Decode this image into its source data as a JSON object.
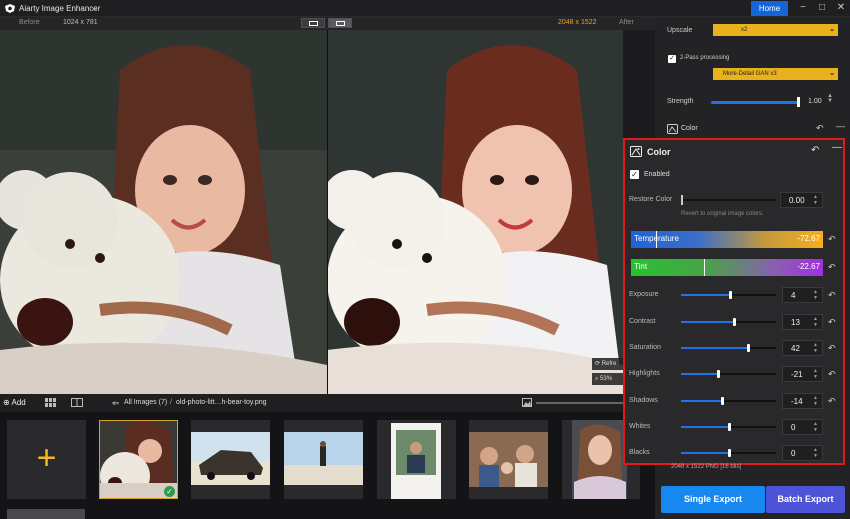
{
  "app": {
    "title": "Aiarty Image Enhancer",
    "dropdown_icon": "chevron-down-icon"
  },
  "titlebar": {
    "home_label": "Home",
    "minimize_glyph": "−",
    "maximize_glyph": "□",
    "close_glyph": "✕"
  },
  "compare": {
    "before_label": "Before",
    "before_size": "1024 x 781",
    "after_size": "2048 x 1522",
    "after_label": "After"
  },
  "preview": {
    "refresh_label": "Refre",
    "zoom_label": "53%"
  },
  "gallery": {
    "add_label": "Add",
    "all_images": "All Images (7)",
    "separator": "/",
    "current_file": "old-photo-litt…h-bear-toy.png"
  },
  "right_panel": {
    "upscale_label": "Upscale",
    "upscale_value": "x2",
    "two_pass_label": "2-Pass processing",
    "two_pass_checked": true,
    "model_value": "More-Detail GAN  v3",
    "strength_label": "Strength",
    "strength_value": "1.00",
    "strength_fraction": 1.0,
    "color_section_label": "Color"
  },
  "color_panel": {
    "title": "Color",
    "enabled_label": "Enabled",
    "enabled_checked": true,
    "restore_label": "Restore Color",
    "restore_value": "0.00",
    "restore_hint": "Revert to original image colors.",
    "temperature": {
      "label": "Temperature",
      "value": "-72.67",
      "position": 0.13
    },
    "tint": {
      "label": "Tint",
      "value": "-22.67",
      "position": 0.38
    },
    "sliders": [
      {
        "label": "Exposure",
        "value": "4",
        "fraction": 0.52,
        "undo": true
      },
      {
        "label": "Contrast",
        "value": "13",
        "fraction": 0.56,
        "undo": true
      },
      {
        "label": "Saturation",
        "value": "42",
        "fraction": 0.71,
        "undo": true
      },
      {
        "label": "Highlights",
        "value": "-21",
        "fraction": 0.39,
        "undo": true
      },
      {
        "label": "Shadows",
        "value": "-14",
        "fraction": 0.43,
        "undo": true
      },
      {
        "label": "Whites",
        "value": "0",
        "fraction": 0.5,
        "undo": false
      },
      {
        "label": "Blacks",
        "value": "0",
        "fraction": 0.5,
        "undo": false
      }
    ]
  },
  "export": {
    "info": "2048 x 1522   PNG   [16 bits]",
    "single_label": "Single Export",
    "batch_label": "Batch Export"
  },
  "colors": {
    "accent": "#1565d8",
    "highlight_border": "#e01a1a",
    "upscale_yellow": "#e9b21d",
    "single_export": "#1688ef",
    "batch_export": "#4d54d8"
  }
}
